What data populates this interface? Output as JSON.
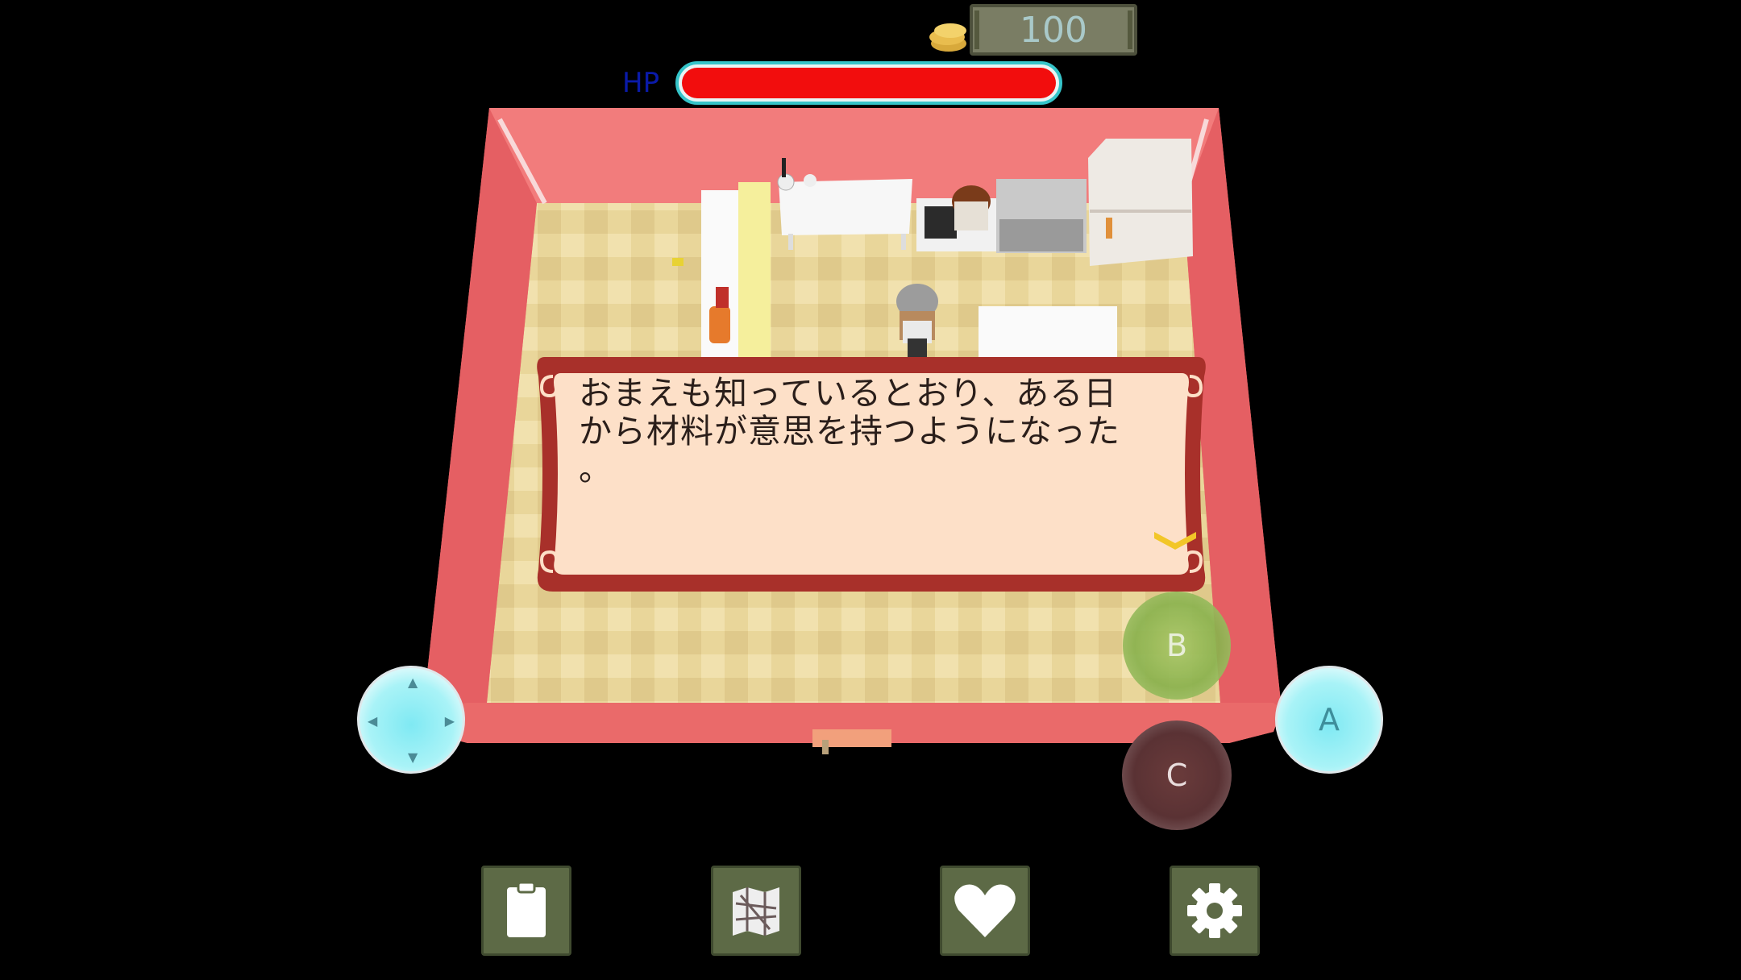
{
  "hud": {
    "coins": "100",
    "hp_label": "HP",
    "hp_fraction": 1.0
  },
  "dialog": {
    "text": "おまえも知っているとおり、ある日\nから材料が意思を持つようになった\n。"
  },
  "controls": {
    "a_label": "A",
    "b_label": "B",
    "c_label": "C"
  },
  "menu": [
    "clipboard-icon",
    "map-icon",
    "heart-icon",
    "gear-icon"
  ],
  "colors": {
    "hp": "#f20d0d",
    "room_wall": "#f07070",
    "dialog_frame": "#a8302a",
    "dialog_bg": "#fde0c8"
  }
}
